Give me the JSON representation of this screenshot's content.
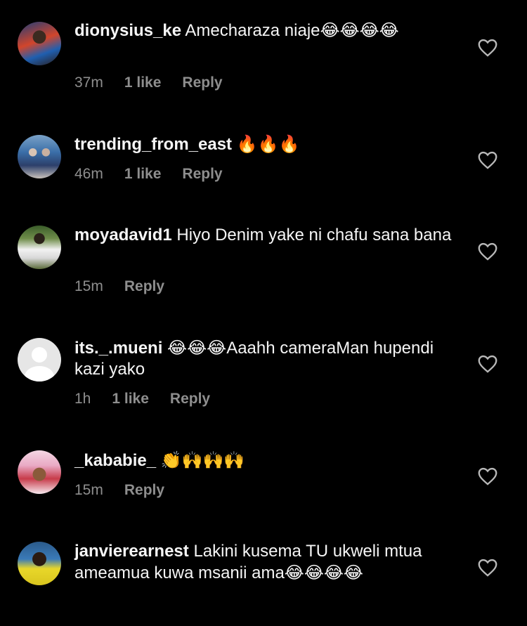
{
  "comments": [
    {
      "username": "dionysius_ke",
      "text": "Amecharaza niaje",
      "emojis": "😂😂😂😂",
      "time": "37m",
      "likes": "1 like",
      "reply": "Reply"
    },
    {
      "username": "trending_from_east",
      "text": "",
      "emojis": "🔥🔥🔥",
      "time": "46m",
      "likes": "1 like",
      "reply": "Reply"
    },
    {
      "username": "moyadavid1",
      "text": "Hiyo Denim yake ni chafu sana bana",
      "emojis": "",
      "time": "15m",
      "likes": "",
      "reply": "Reply"
    },
    {
      "username": "its._.mueni",
      "text_before": "😂😂😂",
      "text": "Aaahh cameraMan hupendi kazi yako",
      "time": "1h",
      "likes": "1 like",
      "reply": "Reply"
    },
    {
      "username": "_kababie_",
      "text": "",
      "emojis": "👏🙌🙌🙌",
      "time": "15m",
      "likes": "",
      "reply": "Reply"
    },
    {
      "username": "janvierearnest",
      "text": "Lakini kusema TU ukweli mtua ameamua kuwa msanii ama",
      "emojis": "😂😂😂😂",
      "time": "",
      "likes": "",
      "reply": ""
    }
  ],
  "icons": {
    "like": "heart-outline-icon",
    "avatar_default": "default-avatar-icon"
  },
  "colors": {
    "background": "#000000",
    "text": "#f5f5f5",
    "meta": "#8e8e8e"
  }
}
